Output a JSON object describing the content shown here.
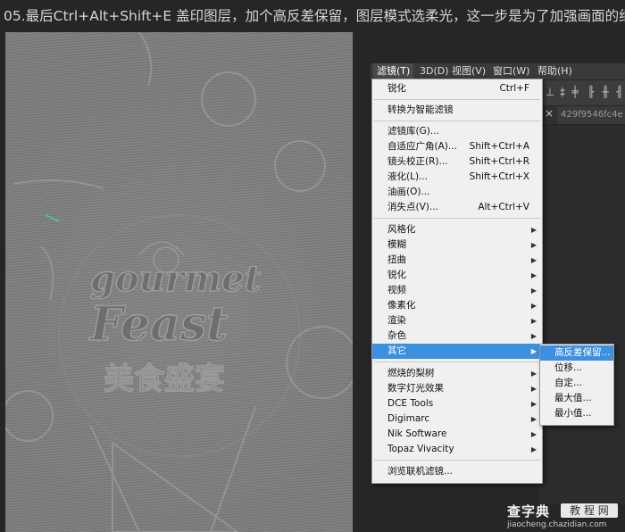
{
  "caption": "05.最后Ctrl+Alt+Shift+E 盖印图层，加个高反差保留，图层模式选柔光，这一步是为了加强画面的细节",
  "canvas_art": {
    "line1": "gourmet",
    "line2": "Feast",
    "line3": "美食盛宴"
  },
  "menubar": {
    "items": [
      "滤镜(T)",
      "3D(D)",
      "视图(V)",
      "窗口(W)",
      "帮助(H)"
    ]
  },
  "doc_tab": {
    "close": "×",
    "name": "429f9546fc4e"
  },
  "filter_menu": {
    "items": [
      {
        "label": "锐化",
        "shortcut": "Ctrl+F"
      },
      {
        "label": "转换为智能滤镜"
      },
      {
        "label": "滤镜库(G)..."
      },
      {
        "label": "自适应广角(A)...",
        "shortcut": "Shift+Ctrl+A"
      },
      {
        "label": "镜头校正(R)...",
        "shortcut": "Shift+Ctrl+R"
      },
      {
        "label": "液化(L)...",
        "shortcut": "Shift+Ctrl+X"
      },
      {
        "label": "油画(O)..."
      },
      {
        "label": "消失点(V)...",
        "shortcut": "Alt+Ctrl+V"
      },
      {
        "label": "风格化"
      },
      {
        "label": "模糊"
      },
      {
        "label": "扭曲"
      },
      {
        "label": "锐化"
      },
      {
        "label": "视频"
      },
      {
        "label": "像素化"
      },
      {
        "label": "渲染"
      },
      {
        "label": "杂色"
      },
      {
        "label": "其它"
      },
      {
        "label": "燃烧的梨树"
      },
      {
        "label": "数字灯光效果"
      },
      {
        "label": "DCE Tools"
      },
      {
        "label": "Digimarc"
      },
      {
        "label": "Nik Software"
      },
      {
        "label": "Topaz Vivacity"
      },
      {
        "label": "浏览联机滤镜..."
      }
    ]
  },
  "other_submenu": {
    "items": [
      "高反差保留...",
      "位移...",
      "自定...",
      "最大值...",
      "最小值..."
    ]
  },
  "watermark": {
    "brand": "查字典",
    "tag": "教 程 网",
    "url": "jiaocheng.chazidian.com"
  }
}
